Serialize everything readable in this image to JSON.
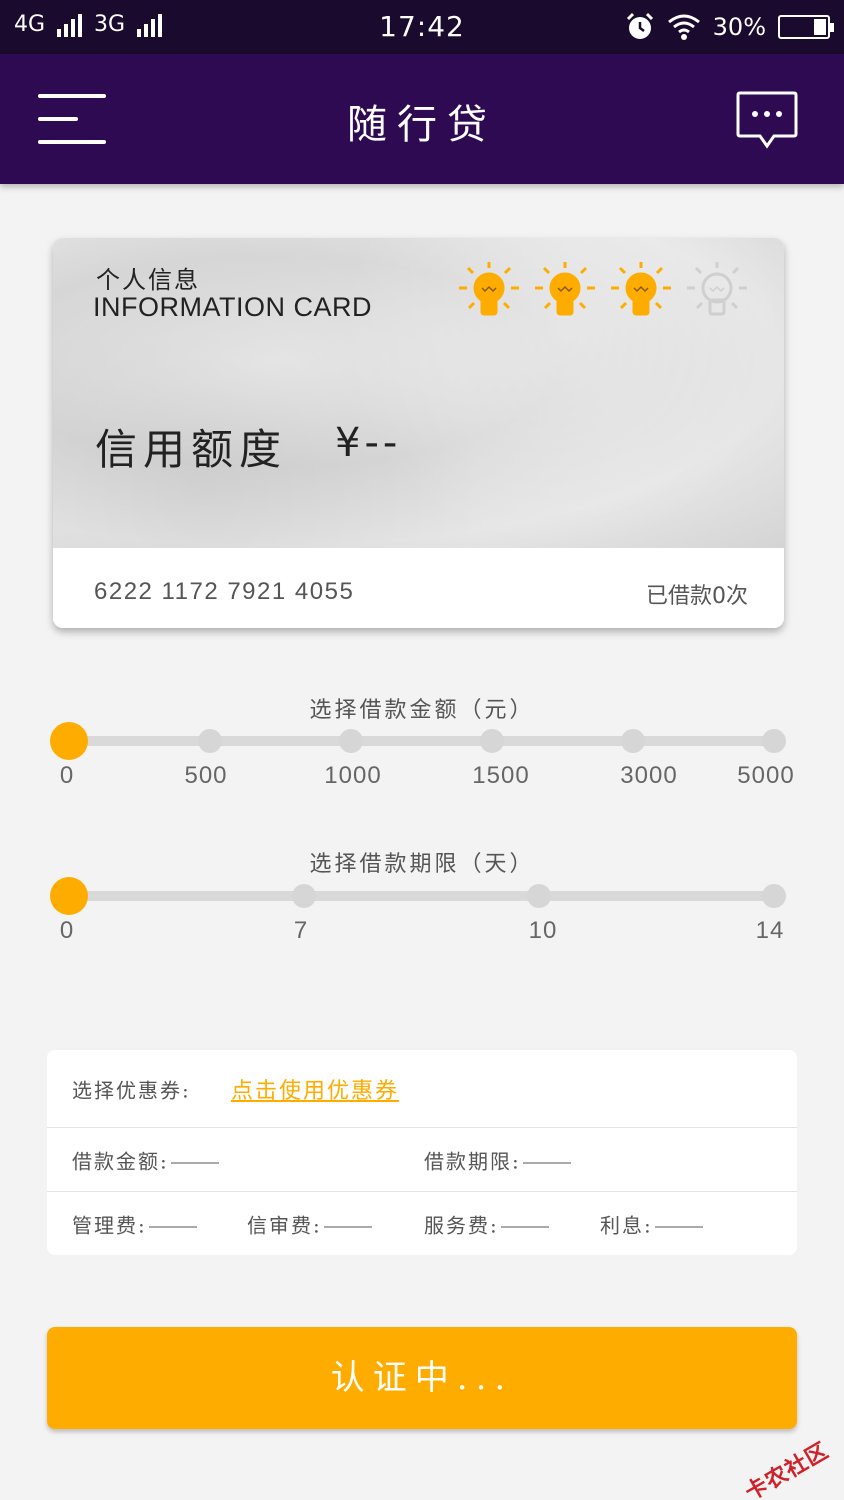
{
  "status_bar": {
    "net1": "4G",
    "net2": "3G",
    "time": "17:42",
    "battery": "30%"
  },
  "header": {
    "title": "随行贷"
  },
  "card": {
    "title_cn": "个人信息",
    "title_en": "INFORMATION CARD",
    "credit_label": "信用额度",
    "credit_value": "¥--",
    "card_number": "6222 1172 7921 4055",
    "borrow_count": "已借款0次",
    "bulbs": [
      {
        "state": "lit",
        "color": "#ffac00"
      },
      {
        "state": "lit",
        "color": "#ffac00"
      },
      {
        "state": "lit",
        "color": "#ffac00"
      },
      {
        "state": "off",
        "color": "#cfcfcf"
      }
    ]
  },
  "amount_slider": {
    "title": "选择借款金额（元）",
    "options": [
      "0",
      "500",
      "1000",
      "1500",
      "3000",
      "5000"
    ],
    "selected": "0"
  },
  "term_slider": {
    "title": "选择借款期限（天）",
    "options": [
      "0",
      "7",
      "10",
      "14"
    ],
    "selected": "0"
  },
  "fees": {
    "coupon_label": "选择优惠券:",
    "coupon_link": "点击使用优惠券",
    "amount_label": "借款金额:",
    "term_label": "借款期限:",
    "management_label": "管理费:",
    "review_label": "信审费:",
    "service_label": "服务费:",
    "interest_label": "利息:"
  },
  "submit": {
    "label": "认证中..."
  },
  "watermark": "卡农社区",
  "colors": {
    "accent": "#ffac00",
    "header_bg": "#2e0a52",
    "status_bg": "#1a0a2e"
  }
}
